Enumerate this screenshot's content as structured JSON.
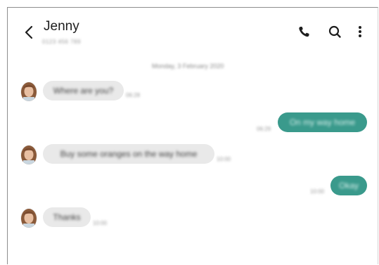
{
  "header": {
    "contact_name": "Jenny",
    "contact_number": "0123 456 789",
    "icons": {
      "back": "back-arrow-icon",
      "call": "phone-icon",
      "search": "search-icon",
      "more": "more-vertical-icon"
    }
  },
  "conversation": {
    "date": "Monday, 3 February 2020",
    "messages": [
      {
        "direction": "incoming",
        "text": "Where are you?",
        "time": "06:28"
      },
      {
        "direction": "outgoing",
        "text": "On my way home",
        "time": "06:29"
      },
      {
        "direction": "incoming",
        "text": "Buy some oranges on the way home",
        "time": "10:00"
      },
      {
        "direction": "outgoing",
        "text": "Okay",
        "time": "10:00"
      },
      {
        "direction": "incoming",
        "text": "Thanks",
        "time": "10:00"
      }
    ]
  },
  "colors": {
    "incoming_bubble": "#e9e9e9",
    "outgoing_bubble": "#3a9a8c",
    "icon": "#1e1e1e"
  }
}
